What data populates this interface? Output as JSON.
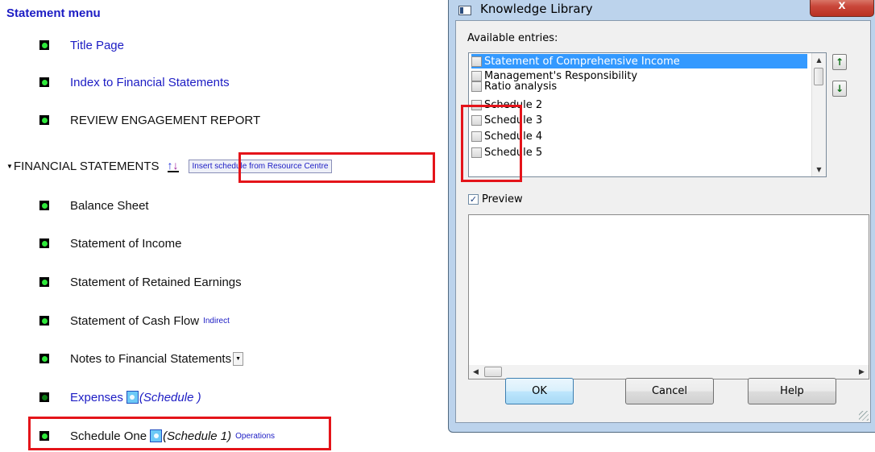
{
  "menu": {
    "title": "Statement menu",
    "items": [
      {
        "label": "Title Page"
      },
      {
        "label": "Index to Financial Statements"
      },
      {
        "label": "REVIEW ENGAGEMENT REPORT"
      },
      {
        "label": "FINANCIAL STATEMENTS",
        "insert_button": "Insert schedule from Resource Centre"
      },
      {
        "label": "Balance Sheet"
      },
      {
        "label": "Statement of Income"
      },
      {
        "label": "Statement of Retained Earnings"
      },
      {
        "label": "Statement of Cash Flow",
        "link": "Indirect"
      },
      {
        "label": "Notes to Financial Statements"
      },
      {
        "label": "Expenses",
        "schedule": "(Schedule )"
      },
      {
        "label": "Schedule One",
        "schedule": "(Schedule 1)",
        "link": "Operations"
      }
    ]
  },
  "dialog": {
    "title": "Knowledge Library",
    "close_label": "x",
    "available_label": "Available entries:",
    "entries": [
      {
        "label": "Statement of Comprehensive Income"
      },
      {
        "label": "Management's Responsibility"
      },
      {
        "label": "Ratio analysis"
      },
      {
        "label": "Schedule 2"
      },
      {
        "label": "Schedule 3"
      },
      {
        "label": "Schedule 4"
      },
      {
        "label": "Schedule 5"
      }
    ],
    "selected_entry": "Statement of Comprehensive Income",
    "preview_label": "Preview",
    "preview_checked": true,
    "buttons": {
      "ok": "OK",
      "cancel": "Cancel",
      "help": "Help"
    }
  },
  "colors": {
    "link_blue": "#1c1cc4",
    "highlight_red": "#e4141a",
    "bullet_green": "#2ee83a",
    "selection_blue": "#3399ff"
  },
  "icons": [
    "green-bullet-icon",
    "sort-arrows-icon",
    "schedule-icon",
    "close-icon",
    "move-up-icon",
    "move-down-icon"
  ]
}
